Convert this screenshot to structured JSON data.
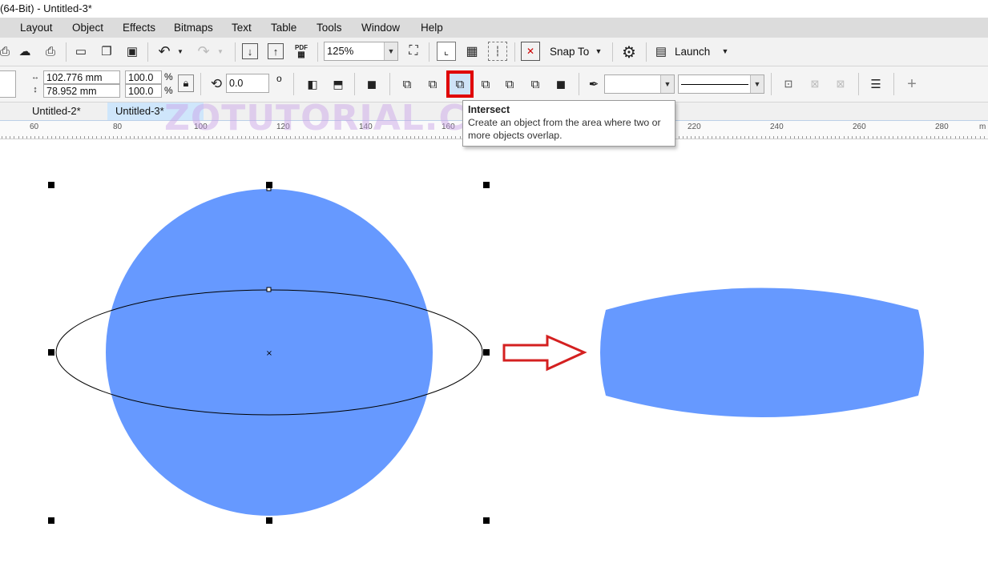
{
  "window": {
    "title": "(64-Bit) - Untitled-3*"
  },
  "menu": {
    "items": [
      {
        "label": "Layout"
      },
      {
        "label": "Object"
      },
      {
        "label": "Effects"
      },
      {
        "label": "Bitmaps"
      },
      {
        "label": "Text"
      },
      {
        "label": "Table"
      },
      {
        "label": "Tools"
      },
      {
        "label": "Window"
      },
      {
        "label": "Help"
      }
    ]
  },
  "toolbar": {
    "pdf_label": "PDF",
    "zoom_value": "125%",
    "snap_label": "Snap To",
    "launch_label": "Launch"
  },
  "properties": {
    "width": "102.776 mm",
    "height": "78.952 mm",
    "scale_x": "100.0",
    "scale_y": "100.0",
    "percent": "%",
    "rotation": "0.0",
    "degree": "o"
  },
  "tabs": [
    {
      "label": "Untitled-2*",
      "active": false
    },
    {
      "label": "Untitled-3*",
      "active": true
    }
  ],
  "ruler": {
    "labels": [
      "60",
      "80",
      "100",
      "120",
      "140",
      "160",
      "220",
      "240",
      "260",
      "280",
      "m"
    ]
  },
  "tooltip": {
    "title": "Intersect",
    "description_line1": "Create an object from the area where two or",
    "description_line2": "more objects overlap."
  },
  "watermark": {
    "text": "ZOTUTORIAL.COM"
  },
  "colors": {
    "shape_fill": "#6699ff",
    "highlight_border": "#e00000",
    "arrow": "#d42020",
    "menubar": "#dcdcdc"
  },
  "icons": [
    "undo-icon",
    "redo-icon",
    "import-icon",
    "export-icon",
    "full-screen-icon",
    "options-gear-icon",
    "weld-icon",
    "trim-icon",
    "intersect-icon",
    "simplify-icon",
    "outline-pen-icon",
    "align-icon",
    "add-icon"
  ]
}
